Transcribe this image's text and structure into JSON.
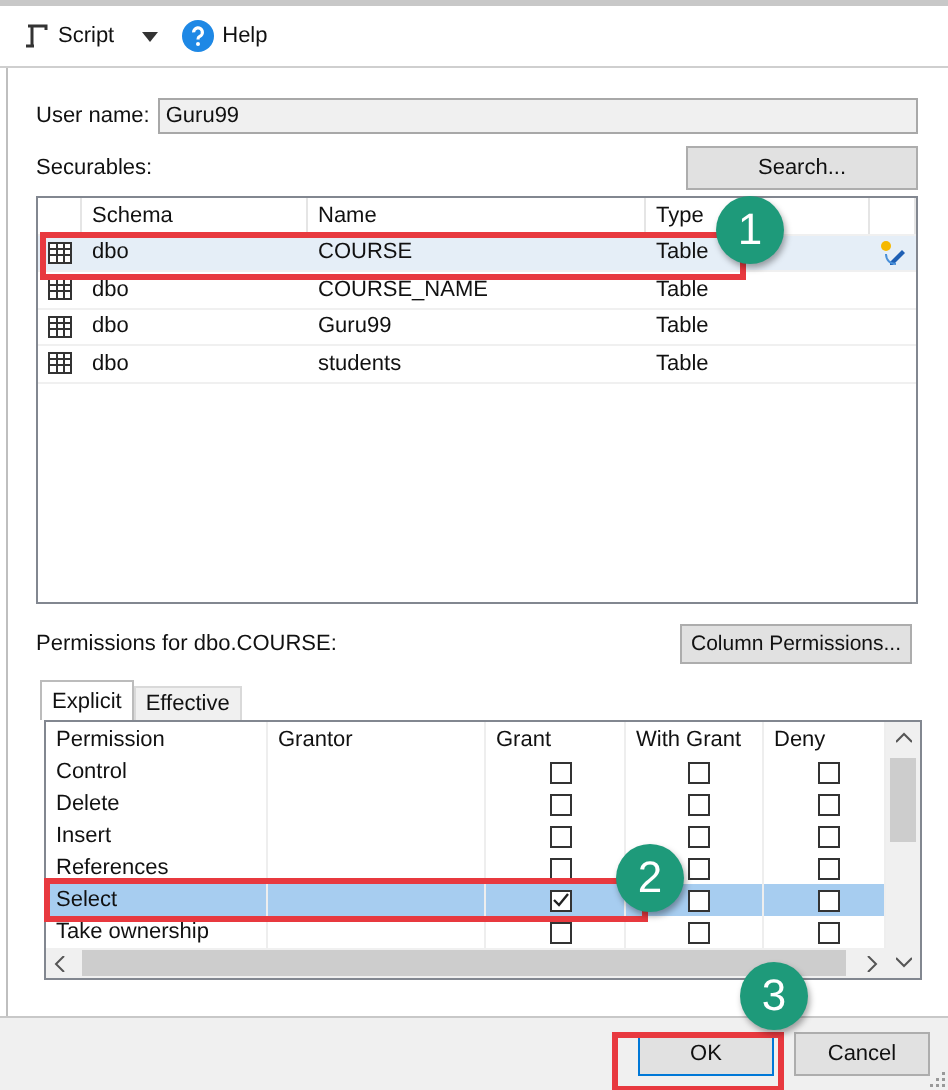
{
  "toolbar": {
    "script": "Script",
    "help": "Help"
  },
  "user_name": {
    "label": "User name:",
    "value": "Guru99"
  },
  "securables": {
    "label": "Securables:",
    "search_button": "Search...",
    "columns": [
      "Schema",
      "Name",
      "Type"
    ],
    "rows": [
      {
        "schema": "dbo",
        "name": "COURSE",
        "type": "Table",
        "selected": true
      },
      {
        "schema": "dbo",
        "name": "COURSE_NAME",
        "type": "Table",
        "selected": false
      },
      {
        "schema": "dbo",
        "name": "Guru99",
        "type": "Table",
        "selected": false
      },
      {
        "schema": "dbo",
        "name": "students",
        "type": "Table",
        "selected": false
      }
    ]
  },
  "permissions": {
    "label": "Permissions for dbo.COURSE:",
    "column_button": "Column Permissions...",
    "tabs": [
      {
        "label": "Explicit",
        "selected": true
      },
      {
        "label": "Effective",
        "selected": false
      }
    ],
    "columns": [
      "Permission",
      "Grantor",
      "Grant",
      "With Grant",
      "Deny"
    ],
    "rows": [
      {
        "permission": "Control",
        "grant": false,
        "with_grant": false,
        "deny": false,
        "selected": false
      },
      {
        "permission": "Delete",
        "grant": false,
        "with_grant": false,
        "deny": false,
        "selected": false
      },
      {
        "permission": "Insert",
        "grant": false,
        "with_grant": false,
        "deny": false,
        "selected": false
      },
      {
        "permission": "References",
        "grant": false,
        "with_grant": false,
        "deny": false,
        "selected": false
      },
      {
        "permission": "Select",
        "grant": true,
        "with_grant": false,
        "deny": false,
        "selected": true
      },
      {
        "permission": "Take ownership",
        "grant": false,
        "with_grant": false,
        "deny": false,
        "selected": false
      }
    ]
  },
  "buttons": [
    {
      "label": "OK",
      "default": true
    },
    {
      "label": "Cancel",
      "default": false
    }
  ],
  "callouts": [
    {
      "number": "1"
    },
    {
      "number": "2"
    },
    {
      "number": "3"
    }
  ]
}
